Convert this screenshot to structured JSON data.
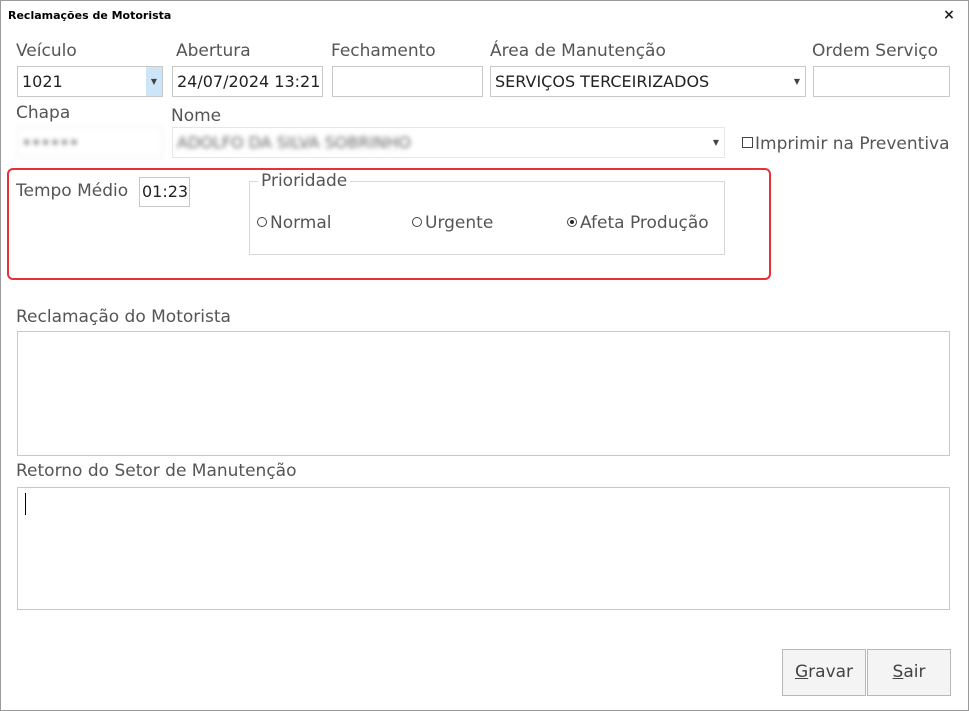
{
  "window": {
    "title": "Reclamações de Motorista",
    "close_glyph": "×"
  },
  "fields": {
    "veiculo": {
      "label": "Veículo",
      "value": "1021"
    },
    "abertura": {
      "label": "Abertura",
      "value": "24/07/2024 13:21"
    },
    "fechamento": {
      "label": "Fechamento",
      "value": ""
    },
    "area_manutencao": {
      "label": "Área de Manutenção",
      "value": "SERVIÇOS TERCEIRIZADOS"
    },
    "ordem_servico": {
      "label": "Ordem Serviço",
      "value": ""
    },
    "chapa": {
      "label": "Chapa",
      "value": "••••••"
    },
    "nome": {
      "label": "Nome",
      "value": "ADOLFO DA SILVA SOBRINHO"
    },
    "imprimir_preventiva": {
      "label": "Imprimir na Preventiva",
      "checked": false
    },
    "tempo_medio": {
      "label": "Tempo Médio",
      "value": "01:23"
    }
  },
  "prioridade": {
    "label": "Prioridade",
    "options": [
      {
        "label": "Normal",
        "selected": false
      },
      {
        "label": "Urgente",
        "selected": false
      },
      {
        "label": "Afeta Produção",
        "selected": true
      }
    ]
  },
  "reclamacao": {
    "label": "Reclamação do Motorista",
    "value": ""
  },
  "retorno": {
    "label": "Retorno do Setor de Manutenção",
    "value": ""
  },
  "buttons": {
    "gravar": {
      "mnemonic": "G",
      "rest": "ravar"
    },
    "sair": {
      "mnemonic": "S",
      "rest": "air"
    }
  },
  "colors": {
    "highlight": "#e8303a",
    "combo_selected": "#cde6f7"
  }
}
